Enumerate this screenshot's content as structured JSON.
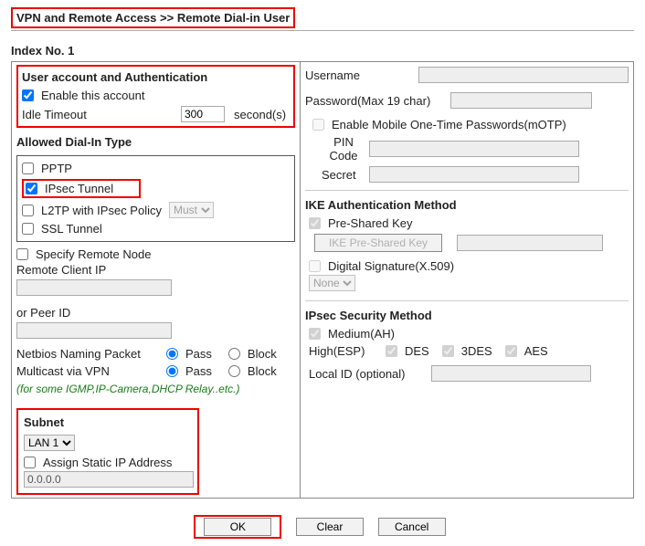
{
  "breadcrumb": "VPN and Remote Access >> Remote Dial-in User",
  "index_label": "Index No. 1",
  "left": {
    "accountAuth": {
      "heading": "User account and Authentication",
      "enable_label": "Enable this account",
      "enable_checked": true,
      "idleTimeout_label": "Idle Timeout",
      "idleTimeout_value": "300",
      "idleTimeout_unit": "second(s)"
    },
    "allowedDialIn": {
      "heading": "Allowed Dial-In Type",
      "pptp": {
        "label": "PPTP",
        "checked": false
      },
      "ipsec": {
        "label": "IPsec Tunnel",
        "checked": true
      },
      "l2tp": {
        "label": "L2TP with IPsec Policy",
        "checked": false,
        "policy_options": [
          "Must"
        ],
        "policy_selected": "Must"
      },
      "ssl": {
        "label": "SSL Tunnel",
        "checked": false
      }
    },
    "specifyRemoteNode": {
      "label": "Specify Remote Node",
      "checked": false
    },
    "remoteClientIp": {
      "label": "Remote Client IP",
      "value": ""
    },
    "orPeerId": {
      "label": "or Peer ID",
      "value": ""
    },
    "netbios": {
      "label": "Netbios Naming Packet",
      "pass": "Pass",
      "block": "Block",
      "selected": "pass"
    },
    "multicast": {
      "label": "Multicast via VPN",
      "pass": "Pass",
      "block": "Block",
      "selected": "pass"
    },
    "note": "(for some IGMP,IP-Camera,DHCP Relay..etc.)",
    "subnet": {
      "heading": "Subnet",
      "options": [
        "LAN 1"
      ],
      "selected": "LAN 1",
      "assignStatic_label": "Assign Static IP Address",
      "assignStatic_checked": false,
      "staticIp_value": "0.0.0.0"
    }
  },
  "right": {
    "username_label": "Username",
    "username_value": "",
    "password_label": "Password(Max 19 char)",
    "password_value": "",
    "motp_label": "Enable Mobile One-Time Passwords(mOTP)",
    "motp_checked": false,
    "pin_label": "PIN Code",
    "pin_value": "",
    "secret_label": "Secret",
    "secret_value": "",
    "ikeAuth": {
      "heading": "IKE Authentication Method",
      "psk_label": "Pre-Shared Key",
      "psk_checked": true,
      "psk_button": "IKE Pre-Shared Key",
      "psk_value": "",
      "ds_label": "Digital Signature(X.509)",
      "ds_checked": false,
      "ds_options": [
        "None"
      ],
      "ds_selected": "None"
    },
    "ipsecSec": {
      "heading": "IPsec Security Method",
      "medium_label": "Medium(AH)",
      "medium_checked": true,
      "high_label": "High(ESP)",
      "des": {
        "label": "DES",
        "checked": true
      },
      "tdes": {
        "label": "3DES",
        "checked": true
      },
      "aes": {
        "label": "AES",
        "checked": true
      },
      "localId_label": "Local ID (optional)",
      "localId_value": ""
    }
  },
  "buttons": {
    "ok": "OK",
    "clear": "Clear",
    "cancel": "Cancel"
  }
}
